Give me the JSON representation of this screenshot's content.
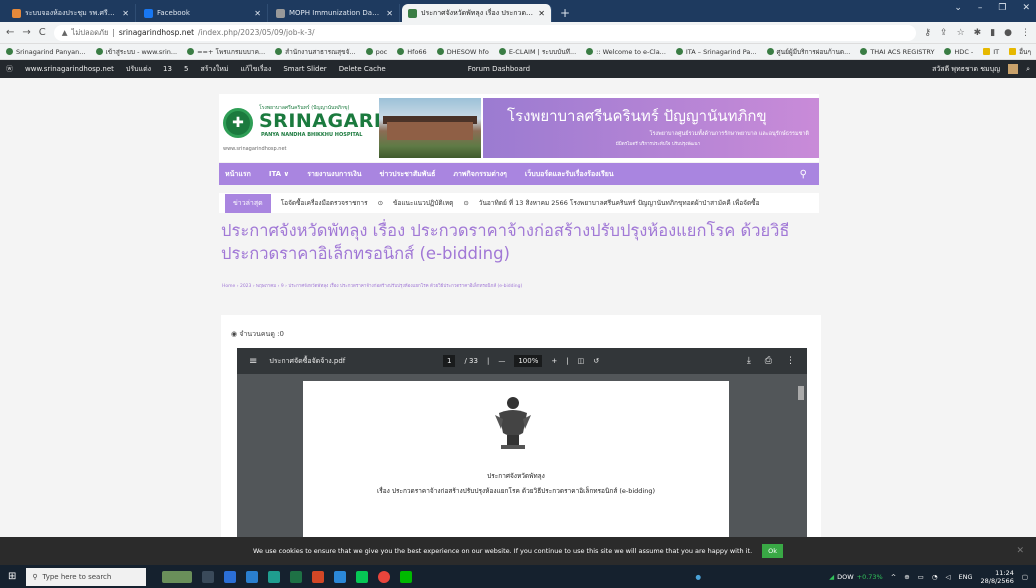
{
  "browser": {
    "tabs": [
      {
        "label": "ระบบจองห้องประชุม รพ.ศรีนครินทร์ปั...",
        "fav_color": "#e6893a",
        "active": false
      },
      {
        "label": "Facebook",
        "fav_color": "#1877f2",
        "active": false
      },
      {
        "label": "MOPH Immunization Dashboard",
        "fav_color": "#999999",
        "active": false
      },
      {
        "label": "ประกาศจังหวัดพัทลุง เรื่อง ประกวดราคา",
        "fav_color": "#3a7d44",
        "active": true
      }
    ],
    "new_tab": "+",
    "address": {
      "warning": "ไม่ปลอดภัย",
      "host": "srinagarindhosp.net",
      "path": "/index.php/2023/05/09/job-k-3/"
    },
    "bookmarks": [
      "Srinagarind Panyan...",
      "เข้าสู่ระบบ - www.srin...",
      "==+ โพรแกรมบบาค...",
      "สำนักงานสาธารณสุขจั...",
      "poc",
      "Hfo66",
      "DHESOW hfo",
      "E-CLAIM | ระบบบันทึ...",
      ":: Welcome to e-Cla...",
      "ITA – Srinagarind Pa...",
      "ศูนย์ผู้มีบริการผ่อนก้านด...",
      "THAI ACS REGISTRY",
      "HDC -",
      "IT",
      "อื่นๆ"
    ]
  },
  "adminbar": {
    "items": [
      "www.srinagarindhosp.net",
      "ปรับแต่ง",
      "13",
      "5",
      "สร้างใหม่",
      "แก้ไขเรื่อง",
      "Smart Slider",
      "Delete Cache",
      "Forum Dashboard"
    ],
    "user": "สวัสดี พุทธชาด ชมบุญ"
  },
  "site": {
    "logo_small": "โรงพยาบาลศรีนครินทร์ (ปัญญานันทภิกขุ)",
    "logo_big": "SRINAGARIND",
    "logo_sub": "PANYA NANDHA BHIKKHU HOSPITAL",
    "logo_url": "www.srinagarindhosp.net",
    "banner_title": "โรงพยาบาลศรีนครินทร์ ปัญญานันทภิกขุ",
    "banner_line2": "โรงพยาบาลศูนย์รวมทั้งด้านการรักษาพยาบาล และอนุรักษ์ธรรมชาติ",
    "banner_line3": "มีมิตรไมตรี บริการประทับใจ ปรับปรุงพัฒนา",
    "nav": [
      "หน้าแรก",
      "ITA ∨",
      "รายงานงบการเงิน",
      "ข่าวประชาสัมพันธ์",
      "ภาพกิจกรรมต่างๆ",
      "เว็บบอร์ดและรับเรื่องร้องเรียน"
    ],
    "news_tag": "ข่าวล่าสุด",
    "news_items": [
      "โอจัดซื้อเครื่องมือตรวจราชการ",
      "ข้อแนะแนวปฏิบัติเหตุ",
      "วันอาทิตย์ ที่ 13 สิงหาคม 2566 โรงพยาบาลศรีนครินทร์ ปัญญานันทภิกขุทอดผ้าป่าสามัคคี เพื่อจัดซื้อ"
    ],
    "title": "ประกาศจังหวัดพัทลุง เรื่อง ประกวดราคาจ้างก่อสร้างปรับปรุงห้องแยกโรค ด้วยวิธีประกวดราคาอิเล็กทรอนิกส์ (e-bidding)",
    "breadcrumb": "Home › 2023 › พฤษภาคม › 9 › ประกาศจังหวัดพัทลุง เรื่อง ประกวดราคาจ้างก่อสร้างปรับปรุงห้องแยกโรค ด้วยวิธีประกวดราคาอิเล็กทรอนิกส์ (e-bidding)",
    "views": "จำนวนคนดู :0"
  },
  "pdf": {
    "filename": "ประกาศจัดซื้อจัดจ้าง.pdf",
    "page": "1",
    "total": "/ 33",
    "zoom": "100%",
    "line1": "ประกาศจังหวัดพัทลุง",
    "line2": "เรื่อง ประกวดราคาจ้างก่อสร้างปรับปรุงห้องแยกโรค ด้วยวิธีประกวดราคาอิเล็กทรอนิกส์ (e-bidding)"
  },
  "cookie": {
    "text": "We use cookies to ensure that we give you the best experience on our website. If you continue to use this site we will assume that you are happy with it.",
    "ok": "Ok"
  },
  "taskbar": {
    "search_placeholder": "Type here to search",
    "stock_name": "DOW",
    "stock_change": "+0.73%",
    "lang": "ENG",
    "time": "11:24",
    "date": "28/8/2566"
  },
  "colors": {
    "accent": "#a985e0",
    "title": "#a178d6",
    "brand_green": "#1b7a3e"
  }
}
